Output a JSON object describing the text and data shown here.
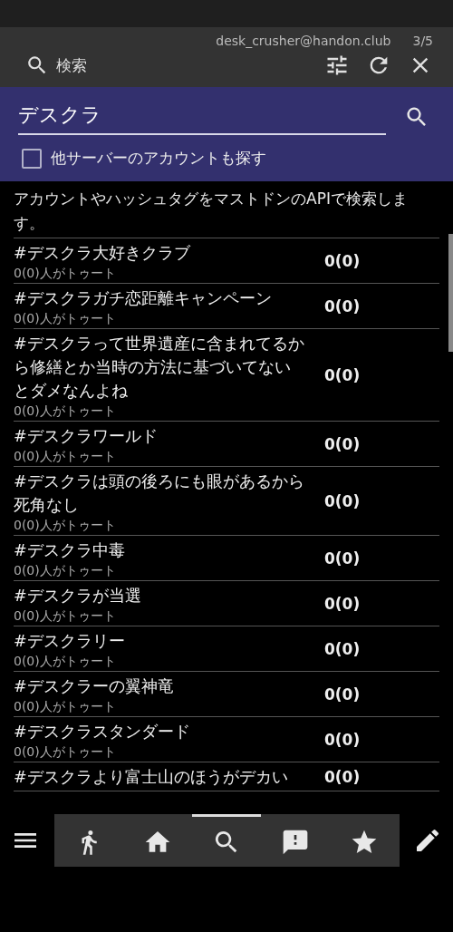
{
  "header": {
    "account": "desk_crusher@handon.club",
    "page_indicator": "3/5",
    "title": "検索"
  },
  "search": {
    "value": "デスクラ",
    "other_servers": {
      "label": "他サーバーのアカウントも探す",
      "checked": false
    }
  },
  "description": "アカウントやハッシュタグをマストドンのAPIで検索します。",
  "results": [
    {
      "tag": "#デスクラ大好きクラブ",
      "subtitle": "0(0)人がトゥート",
      "count": "0(0)"
    },
    {
      "tag": "#デスクラガチ恋距離キャンペーン",
      "subtitle": "0(0)人がトゥート",
      "count": "0(0)"
    },
    {
      "tag": "#デスクラって世界遺産に含まれてるから修繕とか当時の方法に基づいてないとダメなんよね",
      "subtitle": "0(0)人がトゥート",
      "count": "0(0)"
    },
    {
      "tag": "#デスクラワールド",
      "subtitle": "0(0)人がトゥート",
      "count": "0(0)"
    },
    {
      "tag": "#デスクラは頭の後ろにも眼があるから死角なし",
      "subtitle": "0(0)人がトゥート",
      "count": "0(0)"
    },
    {
      "tag": "#デスクラ中毒",
      "subtitle": "0(0)人がトゥート",
      "count": "0(0)"
    },
    {
      "tag": "#デスクラが当選",
      "subtitle": "0(0)人がトゥート",
      "count": "0(0)"
    },
    {
      "tag": "#デスクラリー",
      "subtitle": "0(0)人がトゥート",
      "count": "0(0)"
    },
    {
      "tag": "#デスクラーの翼神竜",
      "subtitle": "0(0)人がトゥート",
      "count": "0(0)"
    },
    {
      "tag": "#デスクラスタンダード",
      "subtitle": "0(0)人がトゥート",
      "count": "0(0)"
    },
    {
      "tag": "#デスクラより富士山のほうがデカい",
      "count": "0(0)"
    }
  ],
  "nav_tabs": [
    {
      "kind": "runner",
      "selected": false
    },
    {
      "kind": "home",
      "selected": false
    },
    {
      "kind": "search",
      "selected": true
    },
    {
      "kind": "notice",
      "selected": false
    },
    {
      "kind": "star",
      "selected": false
    }
  ]
}
